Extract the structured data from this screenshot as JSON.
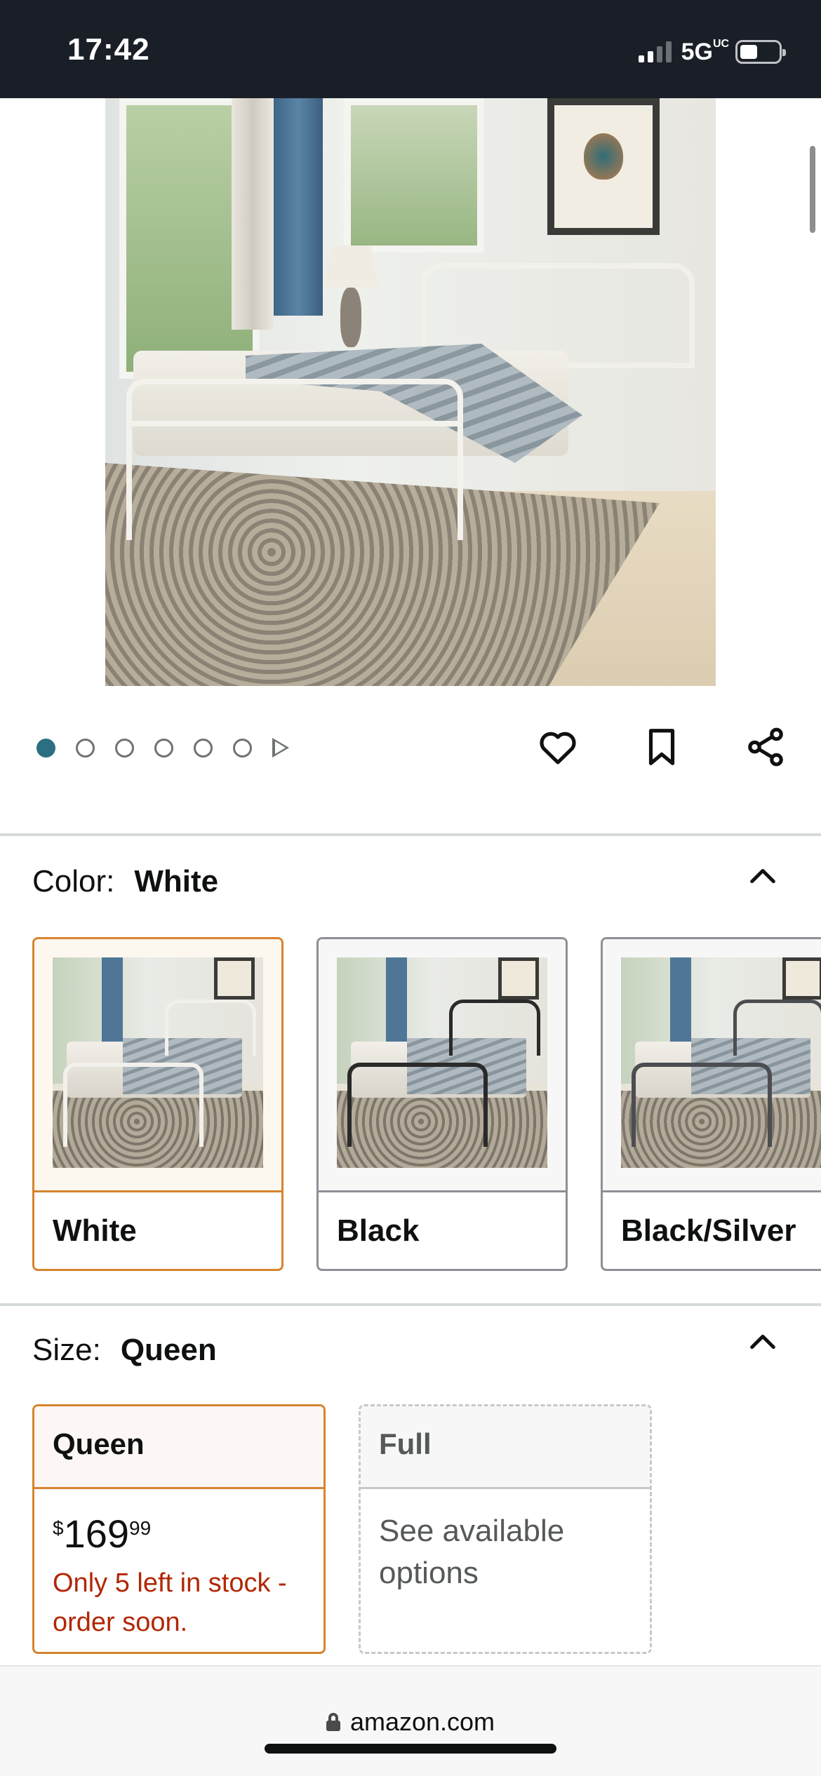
{
  "status_bar": {
    "time": "17:42",
    "network": "5G",
    "network_suffix": "UC",
    "icons": [
      "cellular-signal-icon",
      "battery-icon"
    ]
  },
  "hero": {
    "image_description": "White metal bed frame in a bright bedroom",
    "carousel": {
      "dot_count": 6,
      "active_index": 0,
      "has_video_indicator": true
    },
    "actions": [
      "heart-icon",
      "bookmark-icon",
      "share-icon"
    ]
  },
  "color": {
    "label": "Color:",
    "selected": "White",
    "options": [
      {
        "name": "White",
        "frame_color": "#f2f0ea",
        "selected": true
      },
      {
        "name": "Black",
        "frame_color": "#2a2a2a",
        "selected": false
      },
      {
        "name": "Black/Silver",
        "frame_color": "#4b4d50",
        "selected": false
      }
    ]
  },
  "size": {
    "label": "Size:",
    "selected": "Queen",
    "options": [
      {
        "name": "Queen",
        "price_symbol": "$",
        "price_whole": "169",
        "price_fraction": "99",
        "stock": "Only 5 left in stock - order soon.",
        "selected": true
      },
      {
        "name": "Full",
        "availability": "See available options",
        "selected": false
      }
    ]
  },
  "browser": {
    "url": "amazon.com"
  },
  "colors": {
    "selected_border": "#d6842f",
    "stock_warning": "#b12704",
    "active_dot": "#2c6e82"
  }
}
